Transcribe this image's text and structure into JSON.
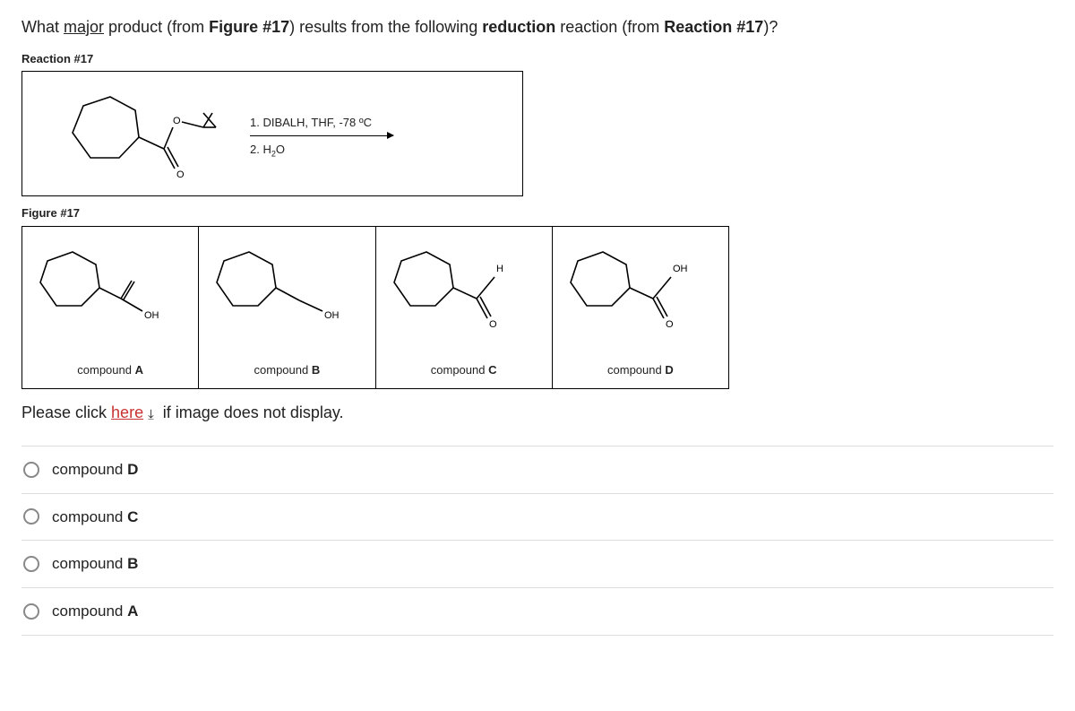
{
  "question": {
    "prefix": "What ",
    "underlined": "major",
    "mid1": " product (from ",
    "bold1": "Figure #17",
    "mid2": ") results from the following ",
    "bold2": "reduction",
    "mid3": " reaction (from ",
    "bold3": "Reaction #17",
    "suffix": ")?"
  },
  "reaction": {
    "label": "Reaction #17",
    "step1": "1. DIBALH, THF, -78 ºC",
    "step2_pre": "2. H",
    "step2_sub": "2",
    "step2_post": "O",
    "ester_O": "O",
    "dbl_O": "O"
  },
  "figure": {
    "label": "Figure #17",
    "oh": "OH",
    "h": "H",
    "dbl_O": "O",
    "compound_prefix": "compound ",
    "cells": [
      {
        "letter": "A"
      },
      {
        "letter": "B"
      },
      {
        "letter": "C"
      },
      {
        "letter": "D"
      }
    ]
  },
  "help": {
    "prefix": "Please click ",
    "link": "here",
    "suffix": " if image does not display."
  },
  "options": [
    {
      "prefix": "compound ",
      "letter": "D"
    },
    {
      "prefix": "compound ",
      "letter": "C"
    },
    {
      "prefix": "compound ",
      "letter": "B"
    },
    {
      "prefix": "compound ",
      "letter": "A"
    }
  ]
}
